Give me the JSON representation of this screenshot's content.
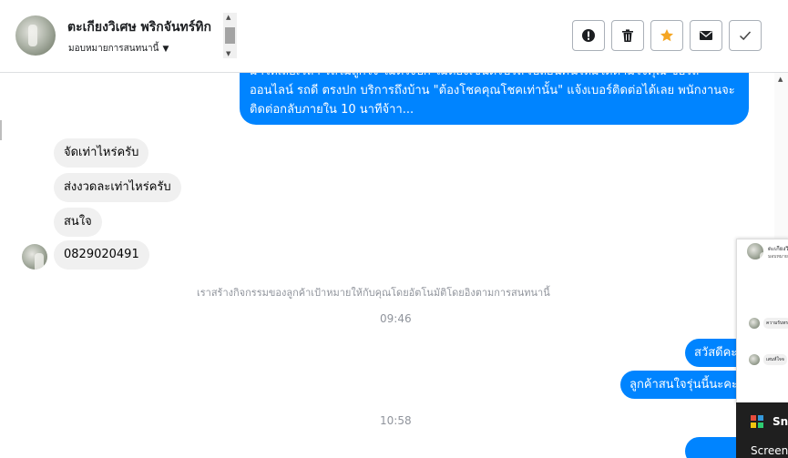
{
  "header": {
    "contact_name": "ตะเกียงวิเศษ พริกจันทร์ทิก",
    "assign_label": "มอบหมายการสนทนานี้"
  },
  "toolbar": {
    "buttons": [
      {
        "name": "spam-button",
        "icon": "alert-icon"
      },
      {
        "name": "delete-button",
        "icon": "trash-icon"
      },
      {
        "name": "star-button",
        "icon": "star-icon",
        "color": "#f5a623"
      },
      {
        "name": "mark-unread-button",
        "icon": "envelope-icon"
      },
      {
        "name": "done-button",
        "icon": "check-icon"
      }
    ]
  },
  "messages": {
    "outgoing_top": "ม่าให้เสียเวลา รถไม่ถูกใจ ไม่ตรงปก ไม่ต้องเซ็นต์รับรถ เปลี่ยนคันใหม่ได้ตามใจคุณ ซื้อรถออนไลน์ รถดี ตรงปก บริการถึงบ้าน \"ต้องโชคคุณโชคเท่านั้น\" แจ้งเบอร์ติดต่อได้เลย พนักงานจะติดต่อกลับภายใน 10 นาทีจ้าา...",
    "incoming": [
      "จัดเท่าไหร่ครับ",
      "ส่งงวดละเท่าไหร่ครับ",
      "สนใจ",
      "0829020491"
    ],
    "system_note": "เราสร้างกิจกรรมของลูกค้าเป้าหมายให้กับคุณโดยอัตโนมัติโดยอิงตามการสนทนานี้",
    "time_1": "09:46",
    "outgoing_1": "สวัสดีคะ",
    "outgoing_2": "ลูกค้าสนใจรุ่นนี้นะคะ",
    "time_2": "10:58"
  },
  "overlay": {
    "popup_title": "ตะเกียงวิเศษ",
    "popup_sub": "มอบหมายการ",
    "popup_msg_1": "ความรับทร",
    "popup_msg_2": "เสนห์ใจจ",
    "taskbar_app": "Sni",
    "taskbar_sub": "Screen"
  },
  "colors": {
    "outgoing_bubble": "#0084ff",
    "incoming_bubble": "#f0f0f0",
    "accent_star": "#f5a623"
  }
}
